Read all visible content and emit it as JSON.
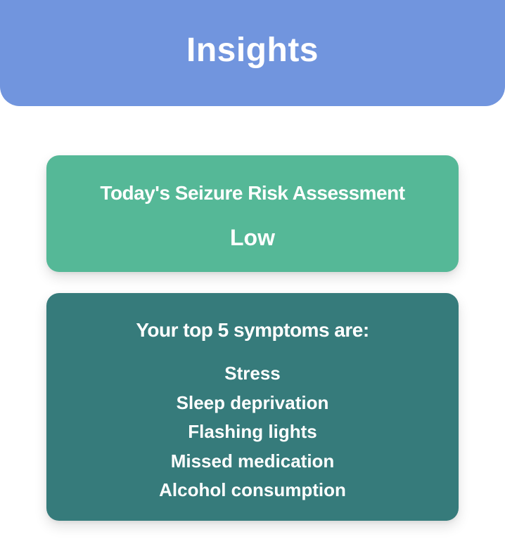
{
  "header": {
    "title": "Insights"
  },
  "risk_card": {
    "title": "Today's Seizure Risk Assessment",
    "value": "Low"
  },
  "symptoms_card": {
    "title": "Your top 5 symptoms are:",
    "items": [
      "Stress",
      "Sleep deprivation",
      "Flashing lights",
      "Missed medication",
      "Alcohol consumption"
    ]
  },
  "colors": {
    "header_bg": "#7195de",
    "risk_card_bg": "#55b897",
    "symptoms_card_bg": "#367b7b",
    "text": "#ffffff"
  }
}
